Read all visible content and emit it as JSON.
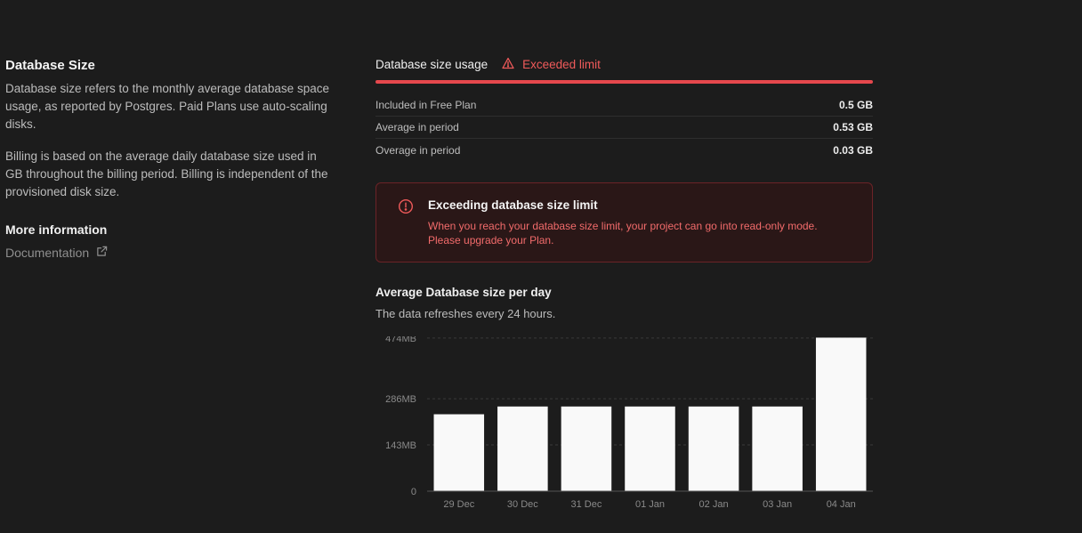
{
  "left": {
    "title": "Database Size",
    "desc1": "Database size refers to the monthly average database space usage, as reported by Postgres. Paid Plans use auto-scaling disks.",
    "desc2": "Billing is based on the average daily database size used in GB throughout the billing period. Billing is independent of the provisioned disk size.",
    "more_info": "More information",
    "doc_link": "Documentation"
  },
  "usage": {
    "title": "Database size usage",
    "status": "Exceeded limit",
    "progress_percent": 100,
    "rows": [
      {
        "label": "Included in Free Plan",
        "value": "0.5 GB"
      },
      {
        "label": "Average in period",
        "value": "0.53 GB"
      },
      {
        "label": "Overage in period",
        "value": "0.03 GB"
      }
    ]
  },
  "alert": {
    "title": "Exceeding database size limit",
    "description": "When you reach your database size limit, your project can go into read-only mode. Please upgrade your Plan."
  },
  "chart_section": {
    "title": "Average Database size per day",
    "subtitle": "The data refreshes every 24 hours."
  },
  "colors": {
    "danger": "#e5484d",
    "bar": "#f9f9f9",
    "background": "#1c1c1c"
  },
  "chart_data": {
    "type": "bar",
    "categories": [
      "29 Dec",
      "30 Dec",
      "31 Dec",
      "01 Jan",
      "02 Jan",
      "03 Jan",
      "04 Jan"
    ],
    "values": [
      238,
      262,
      262,
      262,
      262,
      262,
      475
    ],
    "ylabel": "",
    "yticks": [
      {
        "value": 0,
        "label": "0"
      },
      {
        "value": 143,
        "label": "143MB"
      },
      {
        "value": 286,
        "label": "286MB"
      },
      {
        "value": 474,
        "label": "474MB"
      }
    ],
    "ylim": [
      0,
      479
    ],
    "grid": true
  }
}
